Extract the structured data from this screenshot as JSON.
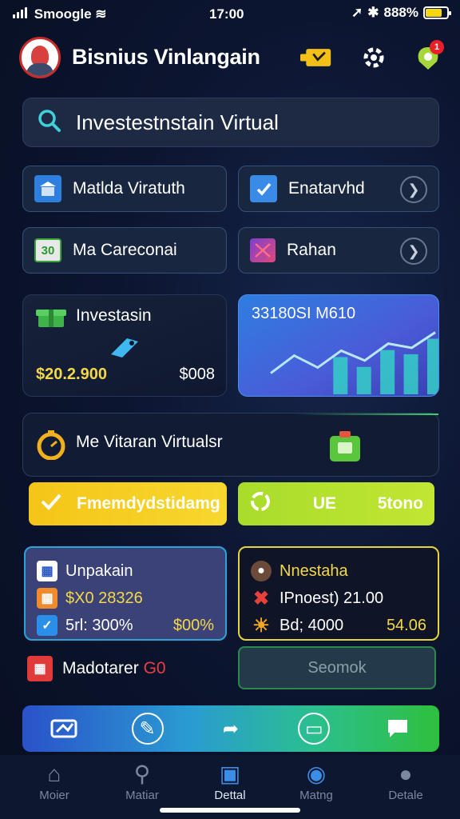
{
  "status_bar": {
    "carrier": "Smoogle",
    "time": "17:00",
    "battery": "888%"
  },
  "header": {
    "title": "Bisnius Vinlangain",
    "notif_count": "1"
  },
  "search": {
    "placeholder": "Investestnstain Virtual"
  },
  "nav_cards": [
    {
      "label": "Matlda Viratuth",
      "icon": "building-icon"
    },
    {
      "label": "Enatarvhd",
      "icon": "check-document-icon"
    },
    {
      "label": "Ma Careconai",
      "icon": "calendar-icon",
      "icon_text": "30"
    },
    {
      "label": "Rahan",
      "icon": "folder-icon"
    }
  ],
  "investasi": {
    "title": "Investasin",
    "amount": "$20.2.900",
    "value": "$008"
  },
  "chart_card": {
    "label": "33180SI M610",
    "trend": [
      0.3,
      0.55,
      0.38,
      0.62,
      0.48,
      0.72,
      0.66,
      0.88
    ]
  },
  "feature": {
    "title": "Me Vitaran Virtualsr"
  },
  "buttons": {
    "primary_label": "Fmemdydstidamg",
    "secondary_label": "UE",
    "secondary_value": "5tono"
  },
  "stat_left": {
    "title": "Unpakain",
    "row1": "$X0 28326",
    "row2_label": "5rl: 300%",
    "row2_value": "$00%"
  },
  "stat_right": {
    "title": "Nnestaha",
    "row1": "IPnoest) 21.00",
    "row2_label": "Bd; 4000",
    "row2_value": "54.06"
  },
  "ads": {
    "left_label": "Madotarer",
    "left_highlight": "G0",
    "right_label": "Seomok"
  },
  "tabs": [
    {
      "label": "Moier",
      "icon": "home-icon"
    },
    {
      "label": "Matiar",
      "icon": "search-icon"
    },
    {
      "label": "Dettal",
      "icon": "box-icon"
    },
    {
      "label": "Matng",
      "icon": "chat-icon"
    },
    {
      "label": "Detale",
      "icon": "person-icon"
    }
  ]
}
